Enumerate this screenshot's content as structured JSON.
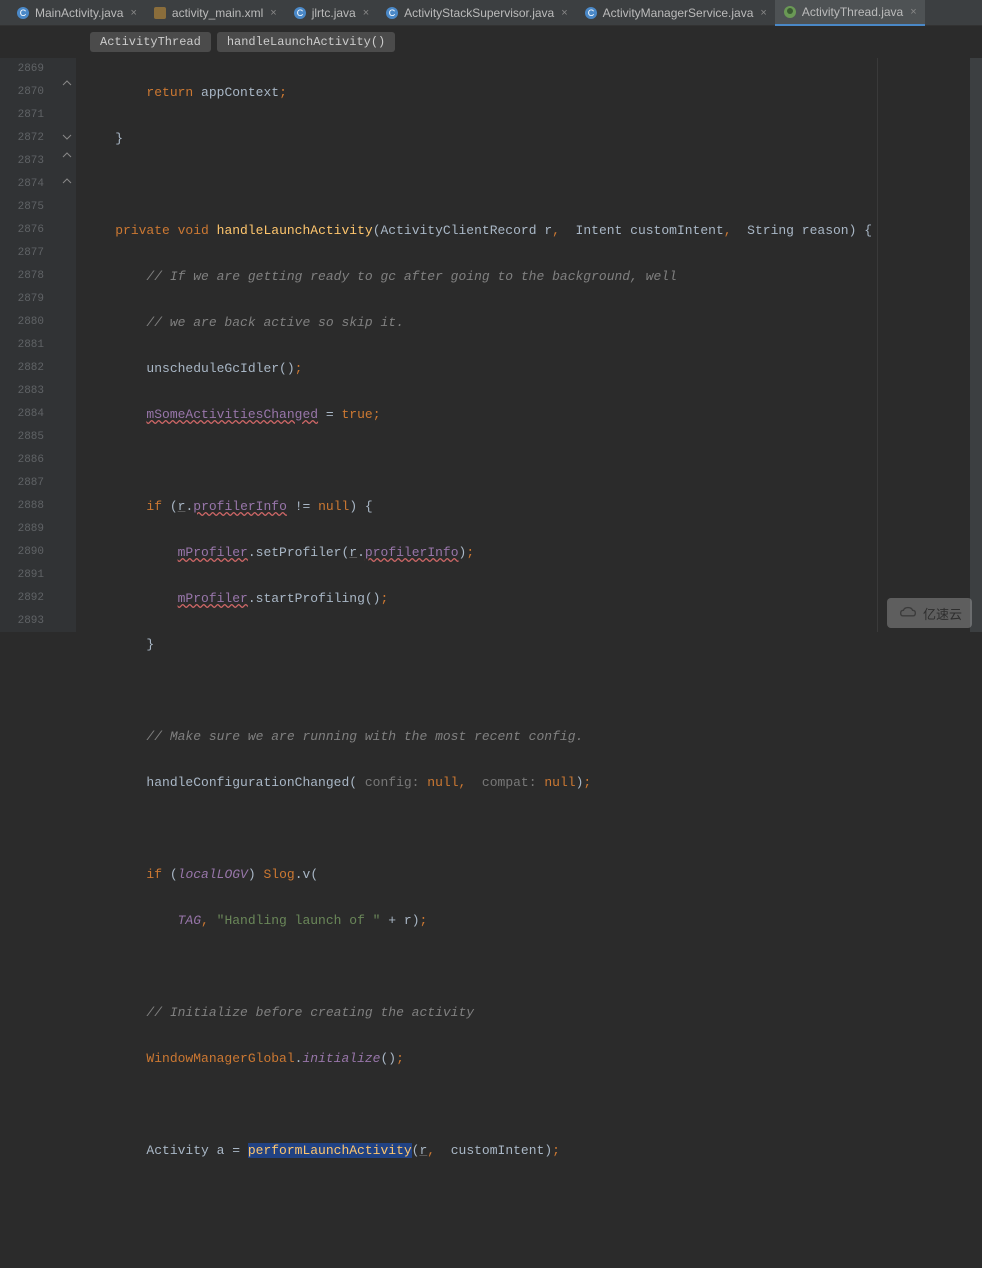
{
  "tabs": [
    {
      "label": "MainActivity.java",
      "icon": "c-icon",
      "active": false
    },
    {
      "label": "activity_main.xml",
      "icon": "xml-icon",
      "active": false
    },
    {
      "label": "jlrtc.java",
      "icon": "c-icon",
      "active": false
    },
    {
      "label": "ActivityStackSupervisor.java",
      "icon": "c-icon",
      "active": false
    },
    {
      "label": "ActivityManagerService.java",
      "icon": "c-icon",
      "active": false
    },
    {
      "label": "ActivityThread.java",
      "icon": "bug-icon",
      "active": true
    }
  ],
  "breadcrumb": {
    "class": "ActivityThread",
    "method": "handleLaunchActivity()"
  },
  "lines": {
    "start": 2869,
    "end": 2893
  },
  "code": {
    "l2869": {
      "return": "return",
      "var": "appContext",
      "semi": ";"
    },
    "l2870": {
      "brace": "}"
    },
    "l2872": {
      "mods": "private void",
      "fn": "handleLaunchActivity",
      "sig1": "(ActivityClientRecord r",
      "c1": ",",
      "sig2": "  Intent customIntent",
      "c2": ",",
      "sig3": "  String reason) {"
    },
    "l2873": {
      "com": "// If we are getting ready to gc after going to the background, well"
    },
    "l2874": {
      "com": "// we are back active so skip it."
    },
    "l2875": {
      "fn": "unscheduleGcIdler",
      "paren": "()",
      "semi": ";"
    },
    "l2876": {
      "field": "mSomeActivitiesChanged",
      "eq": " = ",
      "val": "true",
      "semi": ";"
    },
    "l2878": {
      "if": "if",
      "open": " (",
      "r": "r",
      "dot": ".",
      "prof": "profilerInfo",
      "neq": " != ",
      "null": "null",
      "close": ") {"
    },
    "l2879": {
      "field": "mProfiler",
      "dot1": ".",
      "fn": "setProfiler",
      "open": "(",
      "r": "r",
      "dot2": ".",
      "prof": "profilerInfo",
      "close": ")",
      "semi": ";"
    },
    "l2880": {
      "field": "mProfiler",
      "dot": ".",
      "fn": "startProfiling",
      "paren": "()",
      "semi": ";"
    },
    "l2881": {
      "brace": "}"
    },
    "l2883": {
      "com": "// Make sure we are running with the most recent config."
    },
    "l2884": {
      "fn": "handleConfigurationChanged",
      "open": "(",
      "h1": " config: ",
      "n1": "null",
      "c1": ",",
      "h2": "  compat: ",
      "n2": "null",
      "close": ")",
      "semi": ";"
    },
    "l2886": {
      "if": "if",
      "open": " (",
      "var": "localLOGV",
      "close": ") ",
      "cls": "Slog",
      "dot": ".",
      "fn": "v",
      "paren": "("
    },
    "l2887": {
      "tag": "TAG",
      "c": ",",
      "str": " \"Handling launch of \"",
      "plus": " + r)",
      "semi": ";"
    },
    "l2889": {
      "com": "// Initialize before creating the activity"
    },
    "l2890": {
      "cls": "WindowManagerGlobal",
      "dot": ".",
      "fn": "initialize",
      "paren": "()",
      "semi": ";"
    },
    "l2892": {
      "type": "Activity a = ",
      "fn": "performLaunchActivity",
      "open": "(",
      "r": "r",
      "c": ",",
      "ci": "  customIntent)",
      "semi": ";"
    }
  },
  "watermark": "亿速云"
}
